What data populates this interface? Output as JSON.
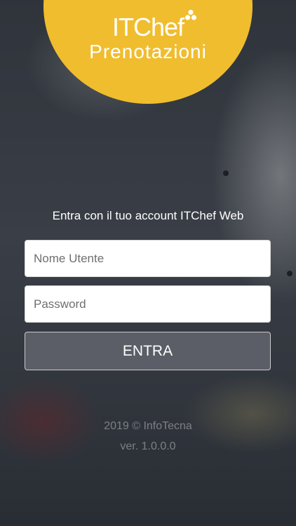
{
  "logo": {
    "title": "ITChef",
    "subtitle": "Prenotazioni",
    "icon": "clover-icon",
    "color": "#f0bd2f"
  },
  "login": {
    "prompt": "Entra con il tuo account ITChef Web",
    "username_placeholder": "Nome Utente",
    "password_placeholder": "Password",
    "submit_label": "ENTRA"
  },
  "footer": {
    "copyright": "2019 © InfoTecna",
    "version": "ver. 1.0.0.0"
  }
}
